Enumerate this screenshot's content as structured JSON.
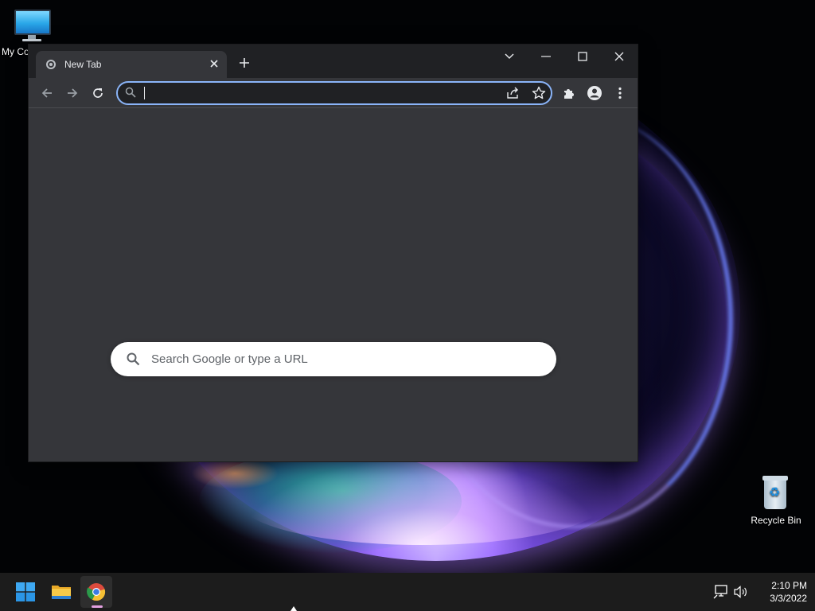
{
  "desktop": {
    "icons": [
      {
        "label": "My Co",
        "icon": "monitor-icon"
      },
      {
        "label": "Recycle Bin",
        "icon": "recycle-bin-icon"
      }
    ]
  },
  "browser": {
    "tab": {
      "title": "New Tab",
      "favicon": "chrome-icon"
    },
    "omnibox": {
      "value": "",
      "placeholder": ""
    },
    "ntp_search_placeholder": "Search Google or type a URL",
    "accent_color": "#8ab4f8",
    "theme": "dark"
  },
  "taskbar": {
    "apps": [
      "start-icon",
      "file-explorer-icon",
      "chrome-icon"
    ],
    "active_app": "chrome-icon",
    "clock": {
      "time": "2:10 PM",
      "date": "3/3/2022"
    }
  }
}
